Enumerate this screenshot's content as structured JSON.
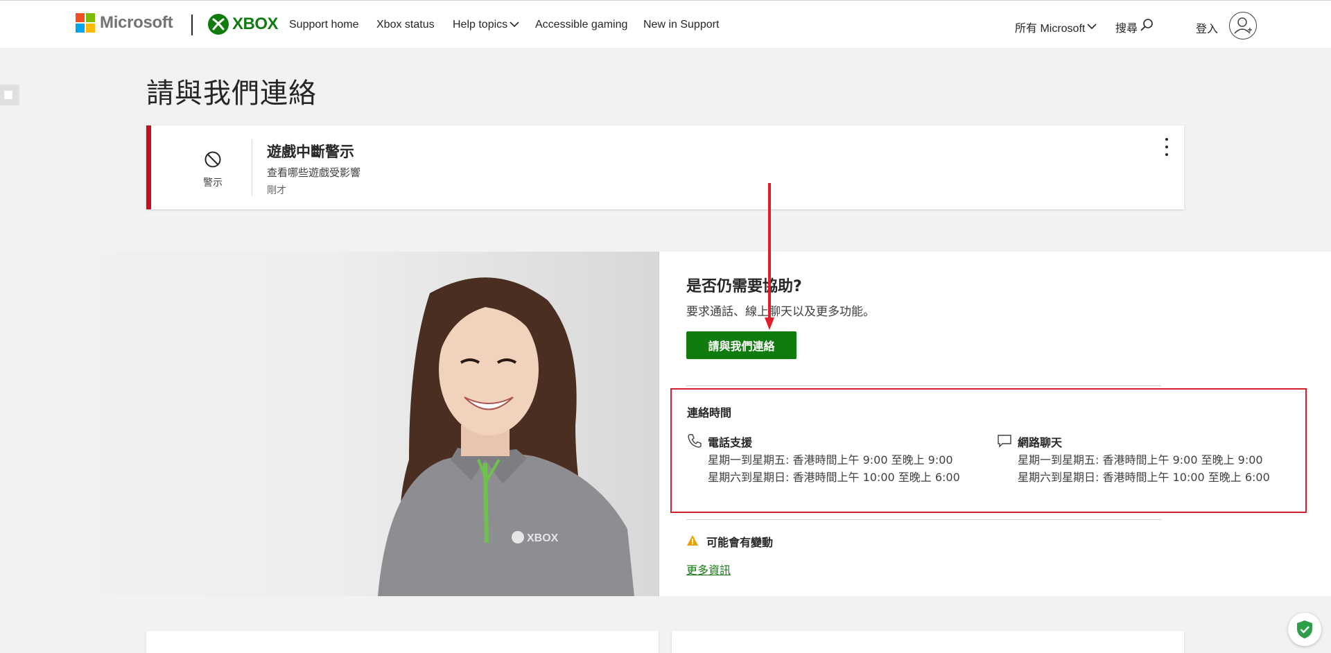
{
  "brand": {
    "microsoft_word": "Microsoft",
    "xbox_word": "XBOX",
    "ms_colors": [
      "#f25022",
      "#7fba00",
      "#00a4ef",
      "#ffb900"
    ],
    "xbox_green": "#107c10"
  },
  "nav": {
    "items": [
      {
        "label": "Support home"
      },
      {
        "label": "Xbox status"
      },
      {
        "label": "Help topics",
        "icon": "chevron-down-icon"
      },
      {
        "label": "Accessible gaming"
      },
      {
        "label": "New in Support"
      }
    ],
    "all_microsoft": "所有 Microsoft",
    "search": "搜尋",
    "signin": "登入"
  },
  "page": {
    "title": "請與我們連絡"
  },
  "alert": {
    "icon": "prohibited-icon",
    "type_label": "警示",
    "title": "遊戲中斷警示",
    "description": "查看哪些遊戲受影響",
    "time": "剛才",
    "accent_color": "#c50f1f"
  },
  "contact": {
    "title": "是否仍需要協助?",
    "description": "要求通話、線上聊天以及更多功能。",
    "button_label": "請與我們連絡",
    "hours": {
      "title": "連絡時間",
      "phone": {
        "icon": "phone-icon",
        "label": "電話支援",
        "weekday": "星期一到星期五: 香港時間上午 9:00 至晚上 9:00",
        "weekend": "星期六到星期日: 香港時間上午 10:00 至晚上 6:00"
      },
      "chat": {
        "icon": "chat-bubble-icon",
        "label": "網路聊天",
        "weekday": "星期一到星期五: 香港時間上午 9:00 至晚上 9:00",
        "weekend": "星期六到星期日: 香港時間上午 10:00 至晚上 6:00"
      }
    },
    "warning": {
      "icon": "warning-icon",
      "label": "可能會有變動"
    },
    "more_link": "更多資訊",
    "highlight_color": "#d21f2c"
  },
  "photo": {
    "shirt_logo": "XBOX"
  }
}
